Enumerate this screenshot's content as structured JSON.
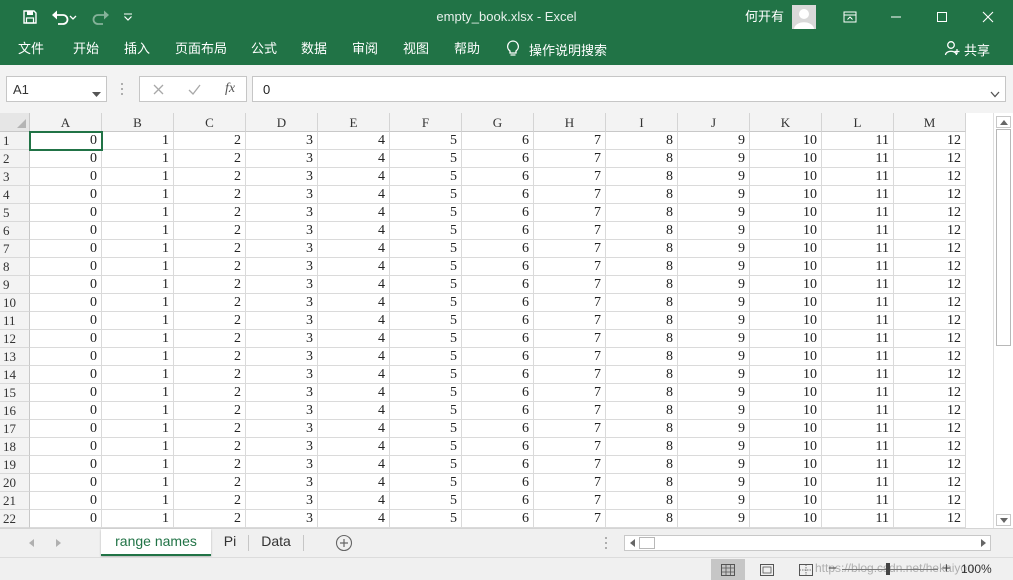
{
  "titlebar": {
    "title": "empty_book.xlsx  -  Excel",
    "user": "何开有",
    "quick_access": [
      "save-icon",
      "undo-icon",
      "redo-icon",
      "customize-qat-icon"
    ],
    "window_controls": [
      "ribbon-display-options-icon",
      "minimize-icon",
      "maximize-icon",
      "close-icon"
    ]
  },
  "ribbon": {
    "tabs": [
      "文件",
      "开始",
      "插入",
      "页面布局",
      "公式",
      "数据",
      "审阅",
      "视图",
      "帮助"
    ],
    "tell_me": "操作说明搜索",
    "share": "共享"
  },
  "formula_bar": {
    "name_box": "A1",
    "formula": "0",
    "fx_label": "fx"
  },
  "grid": {
    "columns": [
      "A",
      "B",
      "C",
      "D",
      "E",
      "F",
      "G",
      "H",
      "I",
      "J",
      "K",
      "L",
      "M"
    ],
    "rows": [
      "1",
      "2",
      "3",
      "4",
      "5",
      "6",
      "7",
      "8",
      "9",
      "10",
      "11",
      "12",
      "13",
      "14",
      "15",
      "16",
      "17",
      "18",
      "19",
      "20",
      "21",
      "22"
    ],
    "row_values": [
      "0",
      "1",
      "2",
      "3",
      "4",
      "5",
      "6",
      "7",
      "8",
      "9",
      "10",
      "11",
      "12"
    ],
    "selected_cell": "A1"
  },
  "sheets": {
    "tabs": [
      "range names",
      "Pi",
      "Data"
    ],
    "active": "range names"
  },
  "statusbar": {
    "zoom": "100%",
    "watermark": "https://blog.csdn.net/hekaiyou"
  },
  "colors": {
    "accent": "#217346",
    "header_bg": "#f3f3f3",
    "gridline": "#dadada"
  }
}
